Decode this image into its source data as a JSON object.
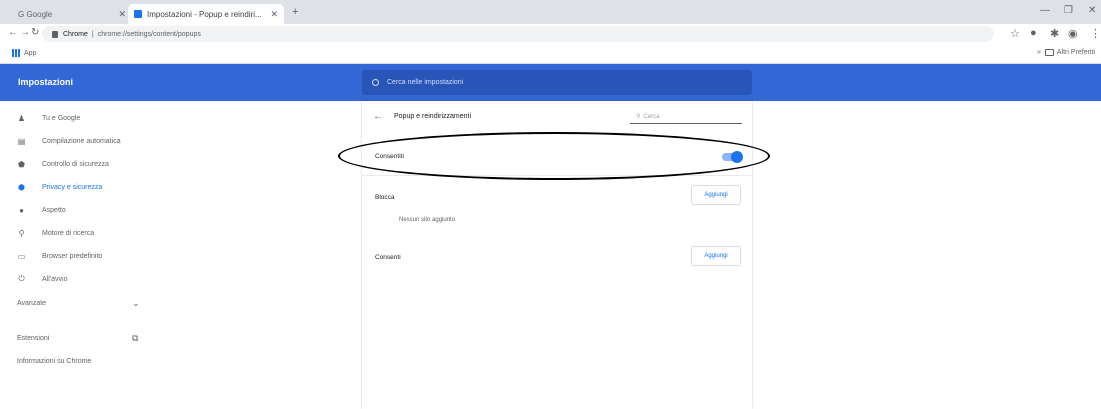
{
  "browser": {
    "tabs": [
      {
        "label": "G Google",
        "active": false
      },
      {
        "label": "Impostazioni - Popup e reindiri...",
        "active": true
      }
    ],
    "url_host": "Chrome",
    "url_path": "chrome://settings/content/popups",
    "bookmarks": {
      "apps_label": "App",
      "other_label": "Altri Preferiti"
    }
  },
  "settings": {
    "title": "Impostazioni",
    "search_placeholder": "Cerca nelle impostazioni",
    "sidebar": {
      "items": [
        {
          "label": "Tu e Google",
          "icon": "person-icon"
        },
        {
          "label": "Compilazione automatica",
          "icon": "clipboard-icon"
        },
        {
          "label": "Controllo di sicurezza",
          "icon": "shield-icon"
        },
        {
          "label": "Privacy e sicurezza",
          "icon": "shield-check-icon",
          "selected": true
        },
        {
          "label": "Aspetto",
          "icon": "palette-icon"
        },
        {
          "label": "Motore di ricerca",
          "icon": "search-icon"
        },
        {
          "label": "Browser predefinito",
          "icon": "browser-icon"
        },
        {
          "label": "All'avvio",
          "icon": "power-icon"
        }
      ],
      "advanced_label": "Avanzate",
      "extensions_label": "Estensioni",
      "about_label": "Informazioni su Chrome"
    },
    "page": {
      "title": "Popup e reindirizzamenti",
      "search_placeholder": "Cerca",
      "allowed_toggle_label": "Consentiti",
      "allowed_toggle_on": true,
      "block_section_label": "Blocca",
      "block_add_label": "Aggiungi",
      "block_empty_message": "Nessun sito aggiunto",
      "allow_section_label": "Consenti",
      "allow_add_label": "Aggiungi"
    }
  },
  "colors": {
    "header_blue": "#3367d6",
    "accent": "#1a73e8",
    "annotation": "#000000"
  }
}
